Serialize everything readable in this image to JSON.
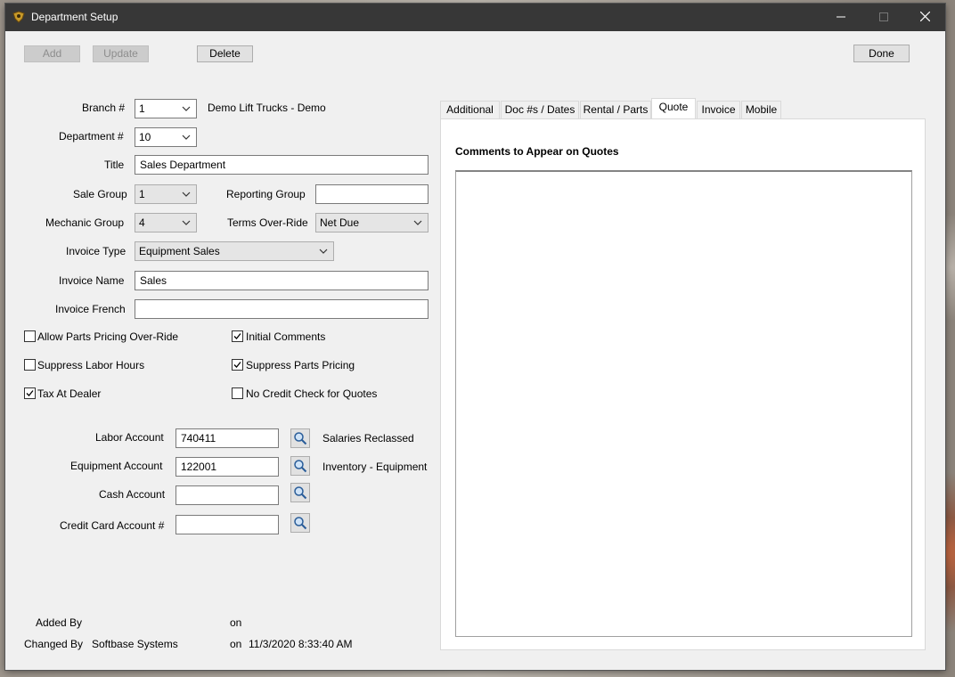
{
  "window": {
    "title": "Department Setup"
  },
  "toolbar": {
    "add": "Add",
    "update": "Update",
    "delete": "Delete",
    "done": "Done"
  },
  "form": {
    "branch": {
      "label": "Branch #",
      "value": "1",
      "name": "Demo Lift Trucks - Demo"
    },
    "department": {
      "label": "Department #",
      "value": "10"
    },
    "title": {
      "label": "Title",
      "value": "Sales Department"
    },
    "sale_group": {
      "label": "Sale Group",
      "value": "1"
    },
    "reporting_group": {
      "label": "Reporting Group",
      "value": ""
    },
    "mechanic_group": {
      "label": "Mechanic Group",
      "value": "4"
    },
    "terms_override": {
      "label": "Terms Over-Ride",
      "value": "Net Due"
    },
    "invoice_type": {
      "label": "Invoice Type",
      "value": "Equipment Sales"
    },
    "invoice_name": {
      "label": "Invoice Name",
      "value": "Sales"
    },
    "invoice_french": {
      "label": "Invoice French",
      "value": ""
    }
  },
  "checkboxes": {
    "allow_parts_pricing": {
      "label": "Allow Parts Pricing Over-Ride",
      "checked": false
    },
    "initial_comments": {
      "label": "Initial Comments",
      "checked": true
    },
    "suppress_labor_hours": {
      "label": "Suppress Labor Hours",
      "checked": false
    },
    "suppress_parts_pricing": {
      "label": "Suppress Parts Pricing",
      "checked": true
    },
    "tax_at_dealer": {
      "label": "Tax At Dealer",
      "checked": true
    },
    "no_credit_check": {
      "label": "No Credit Check for Quotes",
      "checked": false
    }
  },
  "accounts": {
    "labor": {
      "label": "Labor Account",
      "value": "740411",
      "desc": "Salaries Reclassed"
    },
    "equipment": {
      "label": "Equipment Account",
      "value": "122001",
      "desc": "Inventory - Equipment"
    },
    "cash": {
      "label": "Cash Account",
      "value": "",
      "desc": ""
    },
    "credit_card": {
      "label": "Credit Card Account #",
      "value": "",
      "desc": ""
    }
  },
  "audit": {
    "added_by_label": "Added By",
    "added_by": "",
    "added_on_label": "on",
    "added_on": "",
    "changed_by_label": "Changed By",
    "changed_by": "Softbase Systems",
    "changed_on_label": "on",
    "changed_on": "11/3/2020 8:33:40 AM"
  },
  "tabs": [
    "Additional",
    "Doc #s / Dates",
    "Rental / Parts",
    "Quote",
    "Invoice",
    "Mobile"
  ],
  "active_tab": "Quote",
  "quote_tab": {
    "comments_label": "Comments to Appear on Quotes",
    "comments": ""
  },
  "icons": {
    "app": "app-icon",
    "search": "search-icon",
    "dropdown": "chevron-down-icon",
    "check": "check-icon"
  }
}
